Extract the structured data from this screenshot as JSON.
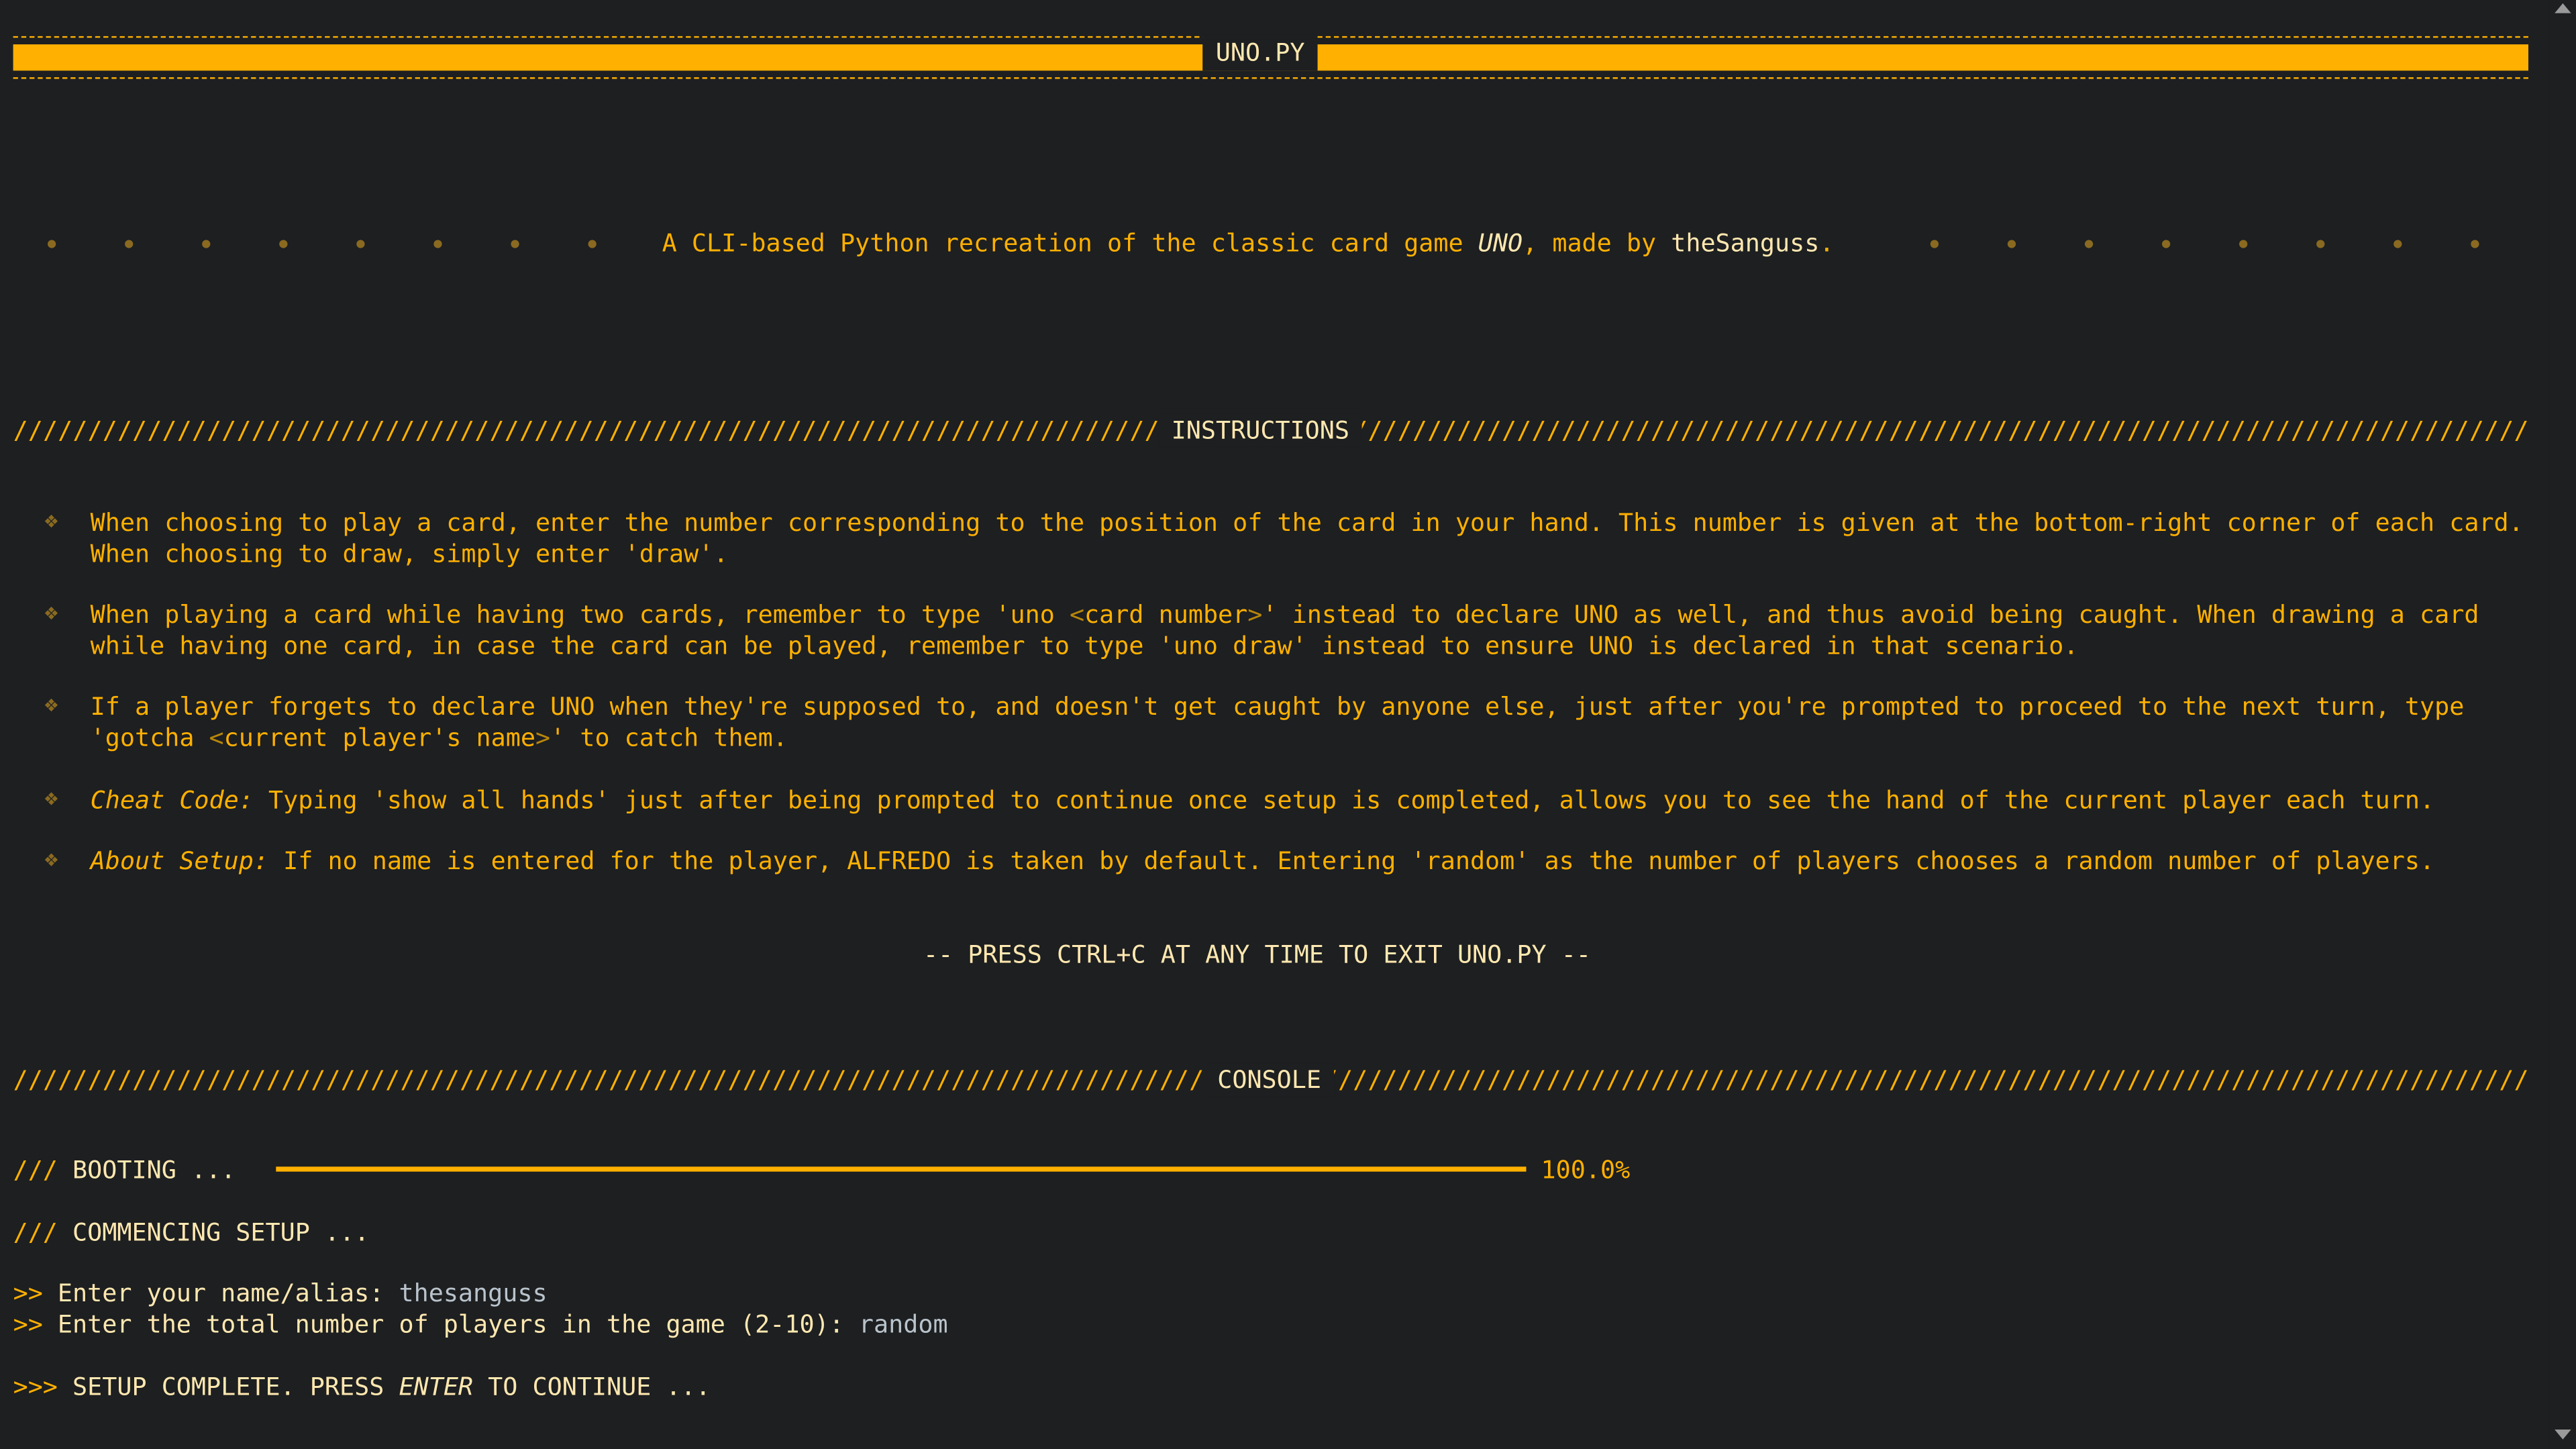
{
  "title": "UNO.PY",
  "tagline": {
    "prefix": "A CLI-based Python recreation of the classic card game ",
    "game": "UNO",
    "middle": ", made by ",
    "author": "theSanguss",
    "suffix": "."
  },
  "instructions": {
    "heading": "INSTRUCTIONS",
    "item1": {
      "text": "When choosing to play a card, enter the number corresponding to the position of the card in your hand. This number is given at the bottom-right corner of each card. When choosing to draw, simply enter 'draw'."
    },
    "item2": {
      "part1": "When playing a card while having two cards, remember to type 'uno ",
      "lt": "<",
      "arg": "card number",
      "gt": ">",
      "part2": "' instead to declare UNO as well, and thus avoid being caught. When drawing a card while having one card, in case the card can be played, remember to type 'uno draw' instead to ensure UNO is declared in that scenario."
    },
    "item3": {
      "part1": "If a player forgets to declare UNO when they're supposed to, and doesn't get caught by anyone else, just after you're prompted to proceed to the next turn, type 'gotcha ",
      "lt": "<",
      "arg": "current player's name",
      "gt": ">",
      "part2": "' to catch them."
    },
    "item4": {
      "label": "Cheat Code:",
      "text": " Typing 'show all hands' just after being prompted to continue once setup is completed, allows you to see the hand of the current player each turn."
    },
    "item5": {
      "label": "About Setup:",
      "text": " If no name is entered for the player, ALFREDO is taken by default. Entering 'random' as the number of players chooses a random number of players."
    },
    "exit_notice": "-- PRESS CTRL+C AT ANY TIME TO EXIT UNO.PY --"
  },
  "console": {
    "heading": "CONSOLE",
    "boot_prefix": "///",
    "boot_label": "BOOTING ...",
    "boot_progress": 1.0,
    "boot_percent": "100.0%",
    "setup_prefix": "///",
    "setup_label": "COMMENCING SETUP ...",
    "prompt_marker": ">>",
    "name_prompt": "Enter your name/alias: ",
    "name_value": "thesanguss",
    "players_prompt": "Enter the total number of players in the game (2-10): ",
    "players_value": "random",
    "complete_marker": ">>>",
    "complete_part1": "SETUP COMPLETE. PRESS ",
    "complete_key": "ENTER",
    "complete_part2": " TO CONTINUE ..."
  },
  "icons": {
    "bullet": "diamond-bullet-icon",
    "scroll_up": "scroll-up-arrow-icon",
    "scroll_down": "scroll-down-arrow-icon"
  }
}
